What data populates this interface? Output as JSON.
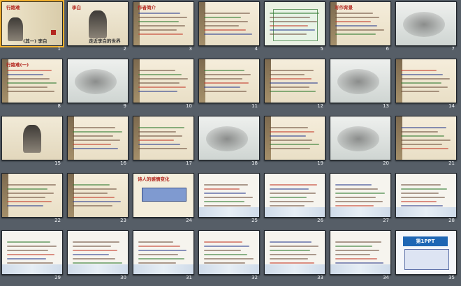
{
  "sorter": {
    "slides": [
      {
        "n": "1",
        "title": "行路难",
        "sub": "(其一) 李白",
        "style": "cover"
      },
      {
        "n": "2",
        "title": "李白",
        "sub": "走近李白的世界",
        "style": "portrait"
      },
      {
        "n": "3",
        "title": "作者简介",
        "style": "text"
      },
      {
        "n": "4",
        "title": "",
        "style": "text"
      },
      {
        "n": "5",
        "title": "",
        "style": "teal"
      },
      {
        "n": "6",
        "title": "写作背景",
        "style": "text"
      },
      {
        "n": "7",
        "title": "",
        "style": "ink"
      },
      {
        "n": "8",
        "title": "行路难(一)",
        "style": "text"
      },
      {
        "n": "9",
        "title": "",
        "style": "ink"
      },
      {
        "n": "10",
        "title": "",
        "style": "text"
      },
      {
        "n": "11",
        "title": "",
        "style": "text"
      },
      {
        "n": "12",
        "title": "",
        "style": "text"
      },
      {
        "n": "13",
        "title": "",
        "style": "ink"
      },
      {
        "n": "14",
        "title": "",
        "style": "text"
      },
      {
        "n": "15",
        "title": "",
        "style": "portrait"
      },
      {
        "n": "16",
        "title": "",
        "style": "text"
      },
      {
        "n": "17",
        "title": "",
        "style": "text"
      },
      {
        "n": "18",
        "title": "",
        "style": "ink"
      },
      {
        "n": "19",
        "title": "",
        "style": "text"
      },
      {
        "n": "20",
        "title": "",
        "style": "ink"
      },
      {
        "n": "21",
        "title": "",
        "style": "text"
      },
      {
        "n": "22",
        "title": "",
        "style": "text"
      },
      {
        "n": "23",
        "title": "",
        "style": "text"
      },
      {
        "n": "24",
        "title": "诗人的感情变化",
        "style": "banner"
      },
      {
        "n": "25",
        "title": "",
        "style": "flower"
      },
      {
        "n": "26",
        "title": "",
        "style": "flower"
      },
      {
        "n": "27",
        "title": "",
        "style": "flower"
      },
      {
        "n": "28",
        "title": "",
        "style": "flower"
      },
      {
        "n": "29",
        "title": "",
        "style": "flower"
      },
      {
        "n": "30",
        "title": "",
        "style": "flower"
      },
      {
        "n": "31",
        "title": "",
        "style": "flower"
      },
      {
        "n": "32",
        "title": "",
        "style": "flower"
      },
      {
        "n": "33",
        "title": "",
        "style": "flower"
      },
      {
        "n": "34",
        "title": "",
        "style": "flower"
      },
      {
        "n": "35",
        "title": "第1PPT",
        "style": "logo"
      }
    ]
  }
}
